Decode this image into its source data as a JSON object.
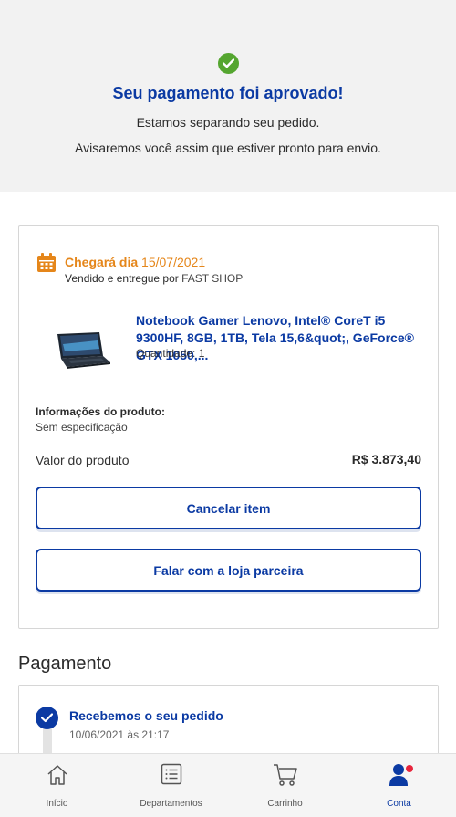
{
  "confirmation": {
    "title": "Seu pagamento foi aprovado!",
    "line1": "Estamos separando seu pedido.",
    "line2": "Avisaremos você assim que estiver pronto para envio."
  },
  "order": {
    "delivery_prefix": "Chegará dia",
    "delivery_date": "15/07/2021",
    "sold_by_prefix": "Vendido e entregue por",
    "seller": "FAST SHOP",
    "product_name": "Notebook Gamer Lenovo, Intel® CoreT i5 9300HF, 8GB, 1TB, Tela 15,6&quot;, GeForce® GTX 1050,...",
    "quantity": "Quantidade: 1",
    "info_label": "Informações do produto:",
    "info_value": "Sem especificação",
    "value_label": "Valor do produto",
    "value_amount": "R$ 3.873,40",
    "cancel_label": "Cancelar item",
    "talk_label": "Falar com a loja parceira"
  },
  "payment": {
    "title": "Pagamento",
    "step_title": "Recebemos o seu pedido",
    "step_date": "10/06/2021 às 21:17"
  },
  "tabbar": {
    "items": [
      {
        "label": "Início",
        "icon": "home-icon"
      },
      {
        "label": "Departamentos",
        "icon": "list-icon"
      },
      {
        "label": "Carrinho",
        "icon": "cart-icon"
      },
      {
        "label": "Conta",
        "icon": "user-icon"
      }
    ],
    "active": "Conta"
  },
  "colors": {
    "brand_blue": "#0b3aa3",
    "success_green": "#55a630",
    "delivery_orange": "#e5861a",
    "badge_red": "#e8253c"
  }
}
